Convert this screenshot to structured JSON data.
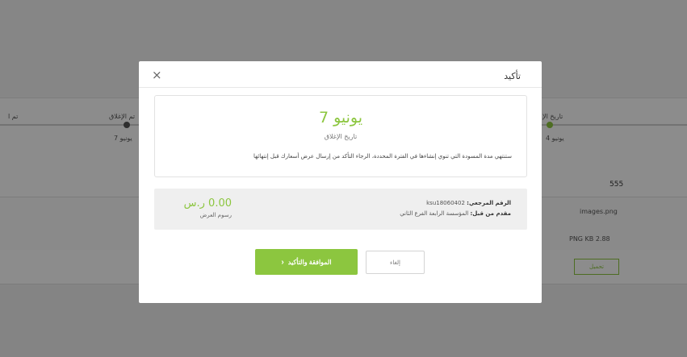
{
  "background": {
    "timeline": {
      "left_label_1": "تم ا",
      "left_label_2": "تم الإغلاق",
      "left_date": "7 يونيو",
      "right_label": "تاريخ الإ",
      "right_date": "4 يونيو"
    },
    "count": "555",
    "file": {
      "name": "images.png",
      "size": "PNG KB 2.88",
      "download": "تحميل"
    }
  },
  "modal": {
    "title": "تأكيد",
    "close_glyph": "×",
    "closing": {
      "date": "7 يونيو",
      "label": "تاريخ الإغلاق",
      "notice": "ستنتهي مدة المسودة التي تنوي إنشاءها في الفترة المحددة، الرجاء التأكد من إرسال عرض أسعارك قبل إنتهائها"
    },
    "summary": {
      "ref_label": "الرقم المرجعي:",
      "ref_value": "ksu18060402",
      "by_label": "مقدم من قبل:",
      "by_value": "المؤسسة الرابعة الفرع الثاني",
      "fee_amount": "0.00 ر.س",
      "fee_label": "رسوم العرض"
    },
    "buttons": {
      "confirm": "الموافقة والتأكيد",
      "cancel": "إلغاء"
    }
  },
  "colors": {
    "accent": "#8cc63f",
    "overlay": "rgba(0,0,0,0.45)"
  }
}
